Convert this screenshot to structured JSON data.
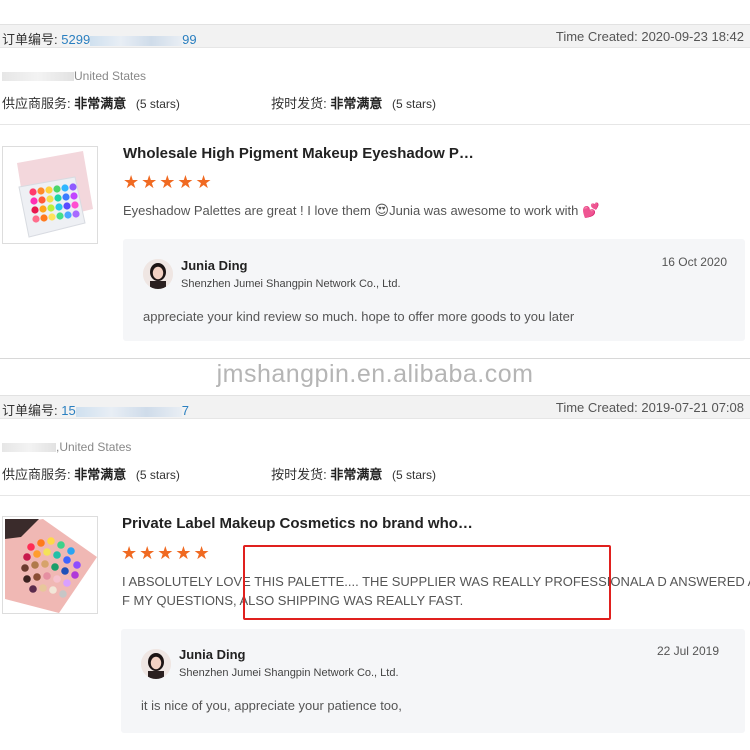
{
  "orders": [
    {
      "order_label": "订单编号:",
      "order_no_visible": "5299",
      "order_no_tail": "99",
      "time_created": "Time Created: 2020-09-23 18:42",
      "buyer_country": "United States",
      "supplier_service_label": "供应商服务:",
      "supplier_service_value": "非常满意",
      "supplier_service_stars": "(5 stars)",
      "shipping_label": "按时发货:",
      "shipping_value": "非常满意",
      "shipping_stars": "(5 stars)",
      "product_title": "Wholesale High Pigment Makeup Eyeshadow P…",
      "stars": "★★★★★",
      "review_text": "Eyeshadow Palettes are great ! I love them",
      "review_text_2": "Junia was awesome to work with",
      "review_emoji_1": "😍",
      "review_emoji_2": "💕",
      "reply_name": "Junia Ding",
      "reply_company": "Shenzhen Jumei Shangpin Network Co., Ltd.",
      "reply_date": "16 Oct 2020",
      "reply_text": "appreciate your kind review so much. hope to offer more goods to you later"
    },
    {
      "order_label": "订单编号:",
      "order_no_visible": "15",
      "order_no_tail": "7",
      "time_created": "Time Created: 2019-07-21 07:08",
      "buyer_country": ",United States",
      "supplier_service_label": "供应商服务:",
      "supplier_service_value": "非常满意",
      "supplier_service_stars": "(5 stars)",
      "shipping_label": "按时发货:",
      "shipping_value": "非常满意",
      "shipping_stars": "(5 stars)",
      "product_title": "Private Label Makeup Cosmetics no brand who…",
      "stars": "★★★★★",
      "review_line_1": "I ABSOLUTELY LOVE THIS PALETTE.... THE SUPPLIER WAS REALLY PROFESSIONALA D ANSWERED ALL O",
      "review_line_2": "F MY QUESTIONS,  ALSO SHIPPING WAS REALLY FAST.",
      "reply_name": "Junia Ding",
      "reply_company": "Shenzhen Jumei Shangpin Network Co., Ltd.",
      "reply_date": "22 Jul 2019",
      "reply_text": "it is nice of you, appreciate your patience too,"
    }
  ],
  "watermark": "jmshangpin.en.alibaba.com",
  "colors": {
    "star": "#f06a22",
    "order_link": "#2a7fc0",
    "highlight": "#e0201e",
    "reply_bg": "#f5f6f8"
  },
  "icons": {
    "avatar": "user-avatar-icon",
    "star": "star-icon"
  }
}
